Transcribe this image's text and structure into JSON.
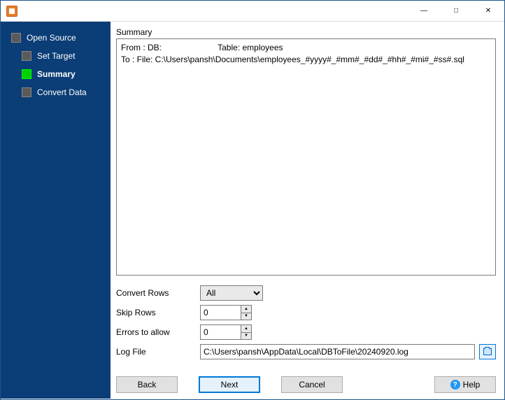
{
  "nav": {
    "items": [
      {
        "label": "Open Source"
      },
      {
        "label": "Set Target"
      },
      {
        "label": "Summary"
      },
      {
        "label": "Convert Data"
      }
    ],
    "activeIndex": 2
  },
  "summary": {
    "title": "Summary",
    "from_prefix": "From : DB:",
    "table_label": "Table: employees",
    "to_line": "To : File: C:\\Users\\pansh\\Documents\\employees_#yyyy#_#mm#_#dd#_#hh#_#mi#_#ss#.sql"
  },
  "options": {
    "convert_rows_label": "Convert Rows",
    "convert_rows_value": "All",
    "skip_rows_label": "Skip Rows",
    "skip_rows_value": "0",
    "errors_label": "Errors to allow",
    "errors_value": "0",
    "logfile_label": "Log File",
    "logfile_value": "C:\\Users\\pansh\\AppData\\Local\\DBToFile\\20240920.log"
  },
  "buttons": {
    "back": "Back",
    "next": "Next",
    "cancel": "Cancel",
    "help": "Help"
  }
}
